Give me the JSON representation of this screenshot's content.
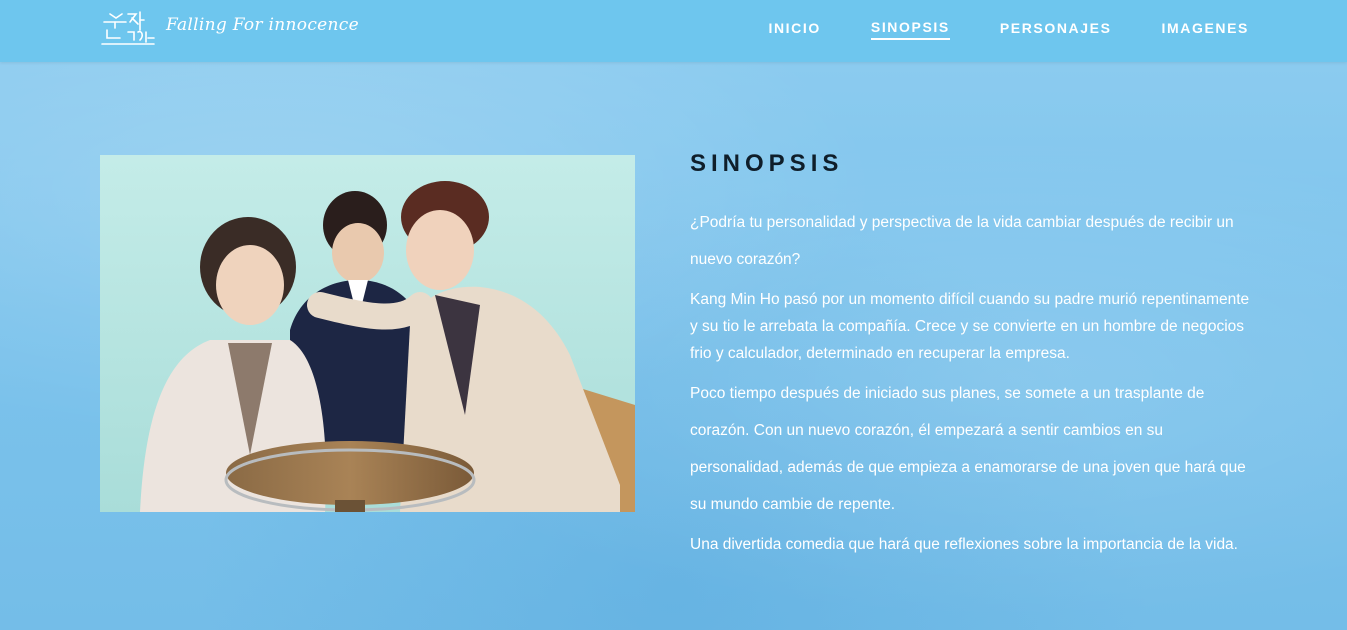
{
  "header": {
    "brand": "Falling For innocence",
    "nav": [
      {
        "label": "INICIO",
        "active": false
      },
      {
        "label": "SINOPSIS",
        "active": true
      },
      {
        "label": "PERSONAJES",
        "active": false
      },
      {
        "label": "IMAGENES",
        "active": false
      }
    ]
  },
  "main": {
    "title": "SINOPSIS",
    "paragraphs": [
      "¿Podría tu personalidad y perspectiva de la vida cambiar después de recibir un nuevo corazón?",
      "Kang Min Ho pasó por un momento difícil cuando su padre murió repentinamente y su tio le arrebata la compañía. Crece y se convierte en un hombre de negocios frio y calculador, determinado en recuperar la empresa.",
      "Poco tiempo después de iniciado sus planes, se somete a un trasplante de corazón. Con un nuevo corazón, él empezará a sentir cambios en su personalidad, además de que empieza a enamorarse de una joven que hará que su mundo cambie de repente.",
      "Una divertida comedia que hará que reflexiones sobre la importancia de la vida."
    ]
  },
  "colors": {
    "header_bg": "#6ec6ee",
    "page_bg": "#7cc3ec",
    "heading": "#0f1e2a",
    "text": "#ffffff"
  }
}
